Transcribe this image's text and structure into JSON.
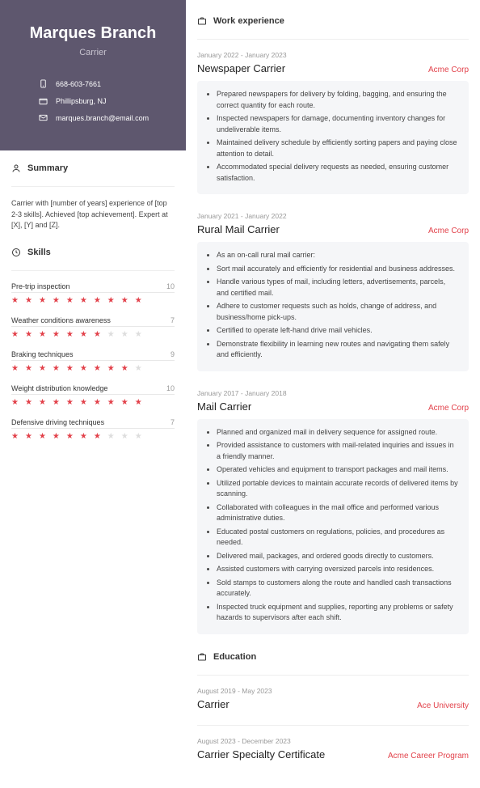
{
  "header": {
    "name": "Marques Branch",
    "title": "Carrier"
  },
  "contacts": {
    "phone": "668-603-7661",
    "location": "Phillipsburg, NJ",
    "email": "marques.branch@email.com"
  },
  "sections": {
    "summary": "Summary",
    "skills": "Skills",
    "work": "Work experience",
    "education": "Education"
  },
  "summary": "Carrier with [number of years] experience of [top 2-3 skills]. Achieved [top achievement]. Expert at [X], [Y] and [Z].",
  "skills": [
    {
      "name": "Pre-trip inspection",
      "value": "10",
      "rating": 10
    },
    {
      "name": "Weather conditions awareness",
      "value": "7",
      "rating": 7
    },
    {
      "name": "Braking techniques",
      "value": "9",
      "rating": 9
    },
    {
      "name": "Weight distribution knowledge",
      "value": "10",
      "rating": 10
    },
    {
      "name": "Defensive driving techniques",
      "value": "7",
      "rating": 7
    }
  ],
  "jobs": [
    {
      "dates": "January 2022 - January 2023",
      "title": "Newspaper Carrier",
      "company": "Acme Corp",
      "bullets": [
        "Prepared newspapers for delivery by folding, bagging, and ensuring the correct quantity for each route.",
        "Inspected newspapers for damage, documenting inventory changes for undeliverable items.",
        "Maintained delivery schedule by efficiently sorting papers and paying close attention to detail.",
        "Accommodated special delivery requests as needed, ensuring customer satisfaction."
      ]
    },
    {
      "dates": "January 2021 - January 2022",
      "title": "Rural Mail Carrier",
      "company": "Acme Corp",
      "bullets": [
        "As an on-call rural mail carrier:",
        "Sort mail accurately and efficiently for residential and business addresses.",
        "Handle various types of mail, including letters, advertisements, parcels, and certified mail.",
        "Adhere to customer requests such as holds, change of address, and business/home pick-ups.",
        "Certified to operate left-hand drive mail vehicles.",
        "Demonstrate flexibility in learning new routes and navigating them safely and efficiently."
      ]
    },
    {
      "dates": "January 2017 - January 2018",
      "title": "Mail Carrier",
      "company": "Acme Corp",
      "bullets": [
        "Planned and organized mail in delivery sequence for assigned route.",
        "Provided assistance to customers with mail-related inquiries and issues in a friendly manner.",
        "Operated vehicles and equipment to transport packages and mail items.",
        "Utilized portable devices to maintain accurate records of delivered items by scanning.",
        "Collaborated with colleagues in the mail office and performed various administrative duties.",
        "Educated postal customers on regulations, policies, and procedures as needed.",
        "Delivered mail, packages, and ordered goods directly to customers.",
        "Assisted customers with carrying oversized parcels into residences.",
        "Sold stamps to customers along the route and handled cash transactions accurately.",
        "Inspected truck equipment and supplies, reporting any problems or safety hazards to supervisors after each shift."
      ]
    }
  ],
  "education": [
    {
      "dates": "August 2019 - May 2023",
      "title": "Carrier",
      "school": "Ace University"
    },
    {
      "dates": "August 2023 - December 2023",
      "title": "Carrier Specialty Certificate",
      "school": "Acme Career Program"
    }
  ]
}
